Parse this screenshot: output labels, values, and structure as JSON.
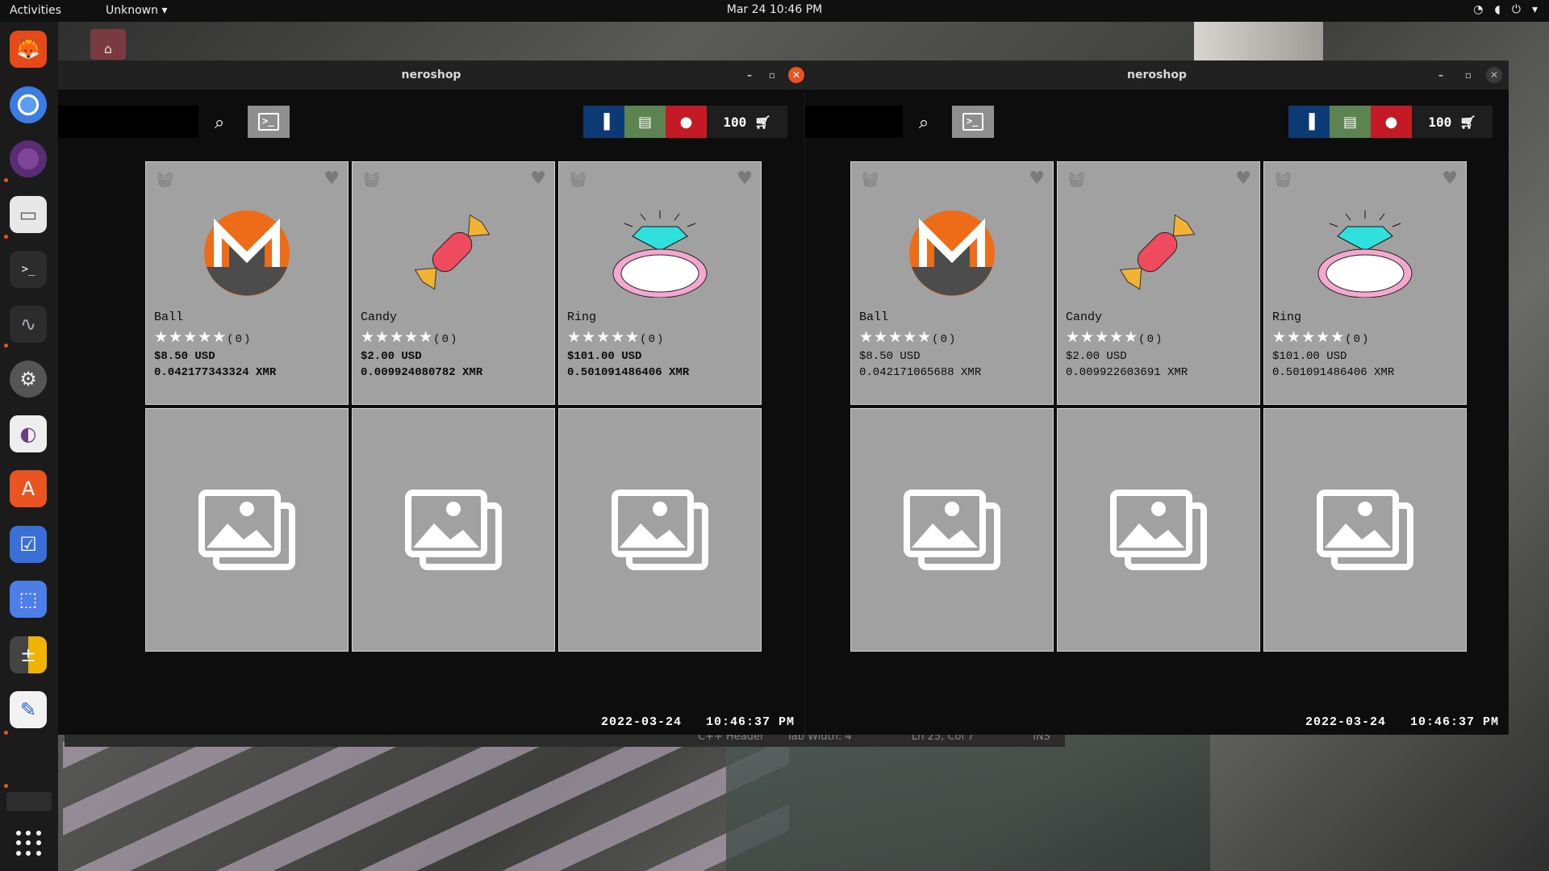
{
  "topbar": {
    "activities": "Activities",
    "app_menu": "Unknown",
    "clock": "Mar 24  10:46 PM",
    "system_icons": [
      "wifi-icon",
      "volume-icon",
      "power-icon"
    ]
  },
  "dock": {
    "apps": [
      "firefox",
      "chromium",
      "tor-browser",
      "files",
      "terminal",
      "system-monitor",
      "settings",
      "tweaks",
      "software",
      "tasks",
      "screenshot",
      "calculator",
      "text-editor"
    ]
  },
  "background_editor": {
    "status": [
      "C++ Header",
      "Tab Width: 4",
      "Ln 25, Col 7",
      "INS"
    ]
  },
  "windows": [
    {
      "title": "neroshop",
      "cart_count": "100",
      "products": [
        {
          "name": "Ball",
          "rating": "★★★★★",
          "reviews": "(0)",
          "usd": "$8.50 USD",
          "xmr": "0.042177343324 XMR"
        },
        {
          "name": "Candy",
          "rating": "★★★★★",
          "reviews": "(0)",
          "usd": "$2.00 USD",
          "xmr": "0.009924080782 XMR"
        },
        {
          "name": "Ring",
          "rating": "★★★★★",
          "reviews": "(0)",
          "usd": "$101.00 USD",
          "xmr": "0.501091486406 XMR"
        }
      ],
      "datetime": "2022-03-24   10:46:37 PM"
    },
    {
      "title": "neroshop",
      "cart_count": "100",
      "products": [
        {
          "name": "Ball",
          "rating": "★★★★★",
          "reviews": "(0)",
          "usd": "$8.50 USD",
          "xmr": "0.042171065688 XMR"
        },
        {
          "name": "Candy",
          "rating": "★★★★★",
          "reviews": "(0)",
          "usd": "$2.00 USD",
          "xmr": "0.009922603691 XMR"
        },
        {
          "name": "Ring",
          "rating": "★★★★★",
          "reviews": "(0)",
          "usd": "$101.00 USD",
          "xmr": "0.501091486406 XMR"
        }
      ],
      "datetime": "2022-03-24   10:46:37 PM"
    }
  ],
  "colors": {
    "accent": "#e95420",
    "card_bg": "#a1a1a1",
    "btn_blue": "#0b3a75",
    "btn_green": "#5d8450",
    "btn_red": "#c41a25"
  }
}
